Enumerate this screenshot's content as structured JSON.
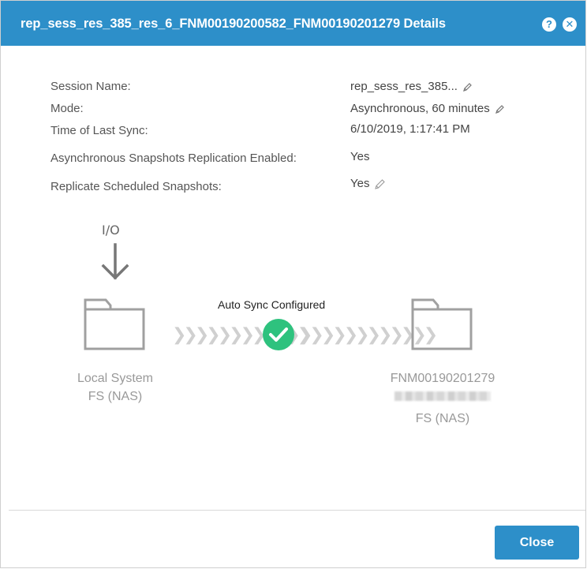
{
  "dialog": {
    "title": "rep_sess_res_385_res_6_FNM00190200582_FNM00190201279 Details",
    "help_icon": "question-circle-icon",
    "close_icon": "close-x-icon"
  },
  "properties": [
    {
      "label": "Session Name:",
      "value": "rep_sess_res_385...",
      "editable": true
    },
    {
      "label": "Mode:",
      "value": "Asynchronous, 60 minutes",
      "editable": true
    },
    {
      "label": "Time of Last Sync:",
      "value": "6/10/2019, 1:17:41 PM",
      "editable": false
    },
    {
      "label": "Asynchronous Snapshots Replication Enabled:",
      "value": "Yes",
      "editable": false
    },
    {
      "label": "Replicate Scheduled Snapshots:",
      "value": "Yes",
      "editable": true
    }
  ],
  "diagram": {
    "io_label": "I/O",
    "sync_status": "Auto Sync Configured",
    "local": {
      "line1": "Local System",
      "line2": "FS (NAS)"
    },
    "remote": {
      "line1": "FNM00190201279",
      "line3": "FS (NAS)"
    },
    "chevrons": "❯❯❯❯❯❯❯❯❯❯❯❯",
    "colors": {
      "status_ok": "#2ec27e",
      "chevron": "#d0d0d0",
      "folder": "#a0a0a0"
    }
  },
  "footer": {
    "close_label": "Close"
  },
  "colors": {
    "accent": "#2d8fc9"
  }
}
